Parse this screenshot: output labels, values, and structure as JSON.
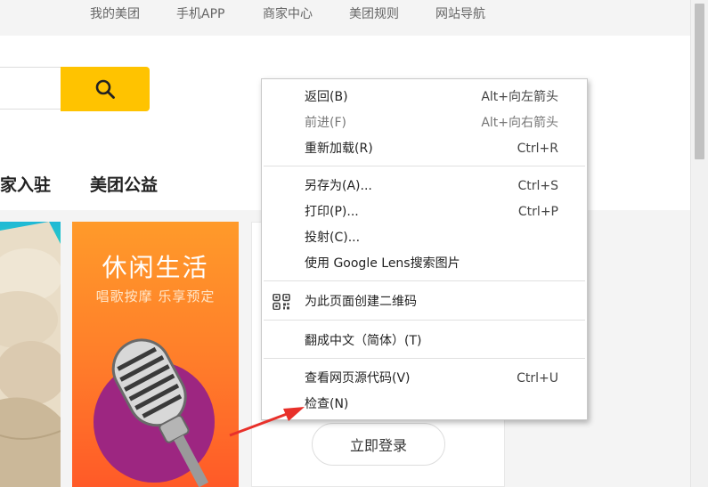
{
  "topnav": {
    "items": [
      "我的美团",
      "手机APP",
      "商家中心",
      "美团规则",
      "网站导航"
    ]
  },
  "catnav": {
    "items": [
      "家入驻",
      "美团公益"
    ]
  },
  "cards": {
    "leisure_title": "休闲生活",
    "leisure_subtitle": "唱歌按摩 乐享预定",
    "login_label": "立即登录"
  },
  "context_menu": {
    "back": {
      "label": "返回(B)",
      "shortcut": "Alt+向左箭头"
    },
    "forward": {
      "label": "前进(F)",
      "shortcut": "Alt+向右箭头"
    },
    "reload": {
      "label": "重新加载(R)",
      "shortcut": "Ctrl+R"
    },
    "save_as": {
      "label": "另存为(A)...",
      "shortcut": "Ctrl+S"
    },
    "print": {
      "label": "打印(P)...",
      "shortcut": "Ctrl+P"
    },
    "cast": {
      "label": "投射(C)..."
    },
    "lens": {
      "label": "使用 Google Lens搜索图片"
    },
    "qr": {
      "label": "为此页面创建二维码"
    },
    "translate": {
      "label": "翻成中文（简体）(T)"
    },
    "view_source": {
      "label": "查看网页源代码(V)",
      "shortcut": "Ctrl+U"
    },
    "inspect": {
      "label": "检查(N)"
    }
  },
  "colors": {
    "search_button": "#ffc300",
    "leisure_card": "#ff7f2a",
    "annotation_arrow": "#e8302a"
  },
  "icons": {
    "search": "search-icon",
    "qr": "qr-code-icon",
    "microphone": "microphone-image"
  }
}
